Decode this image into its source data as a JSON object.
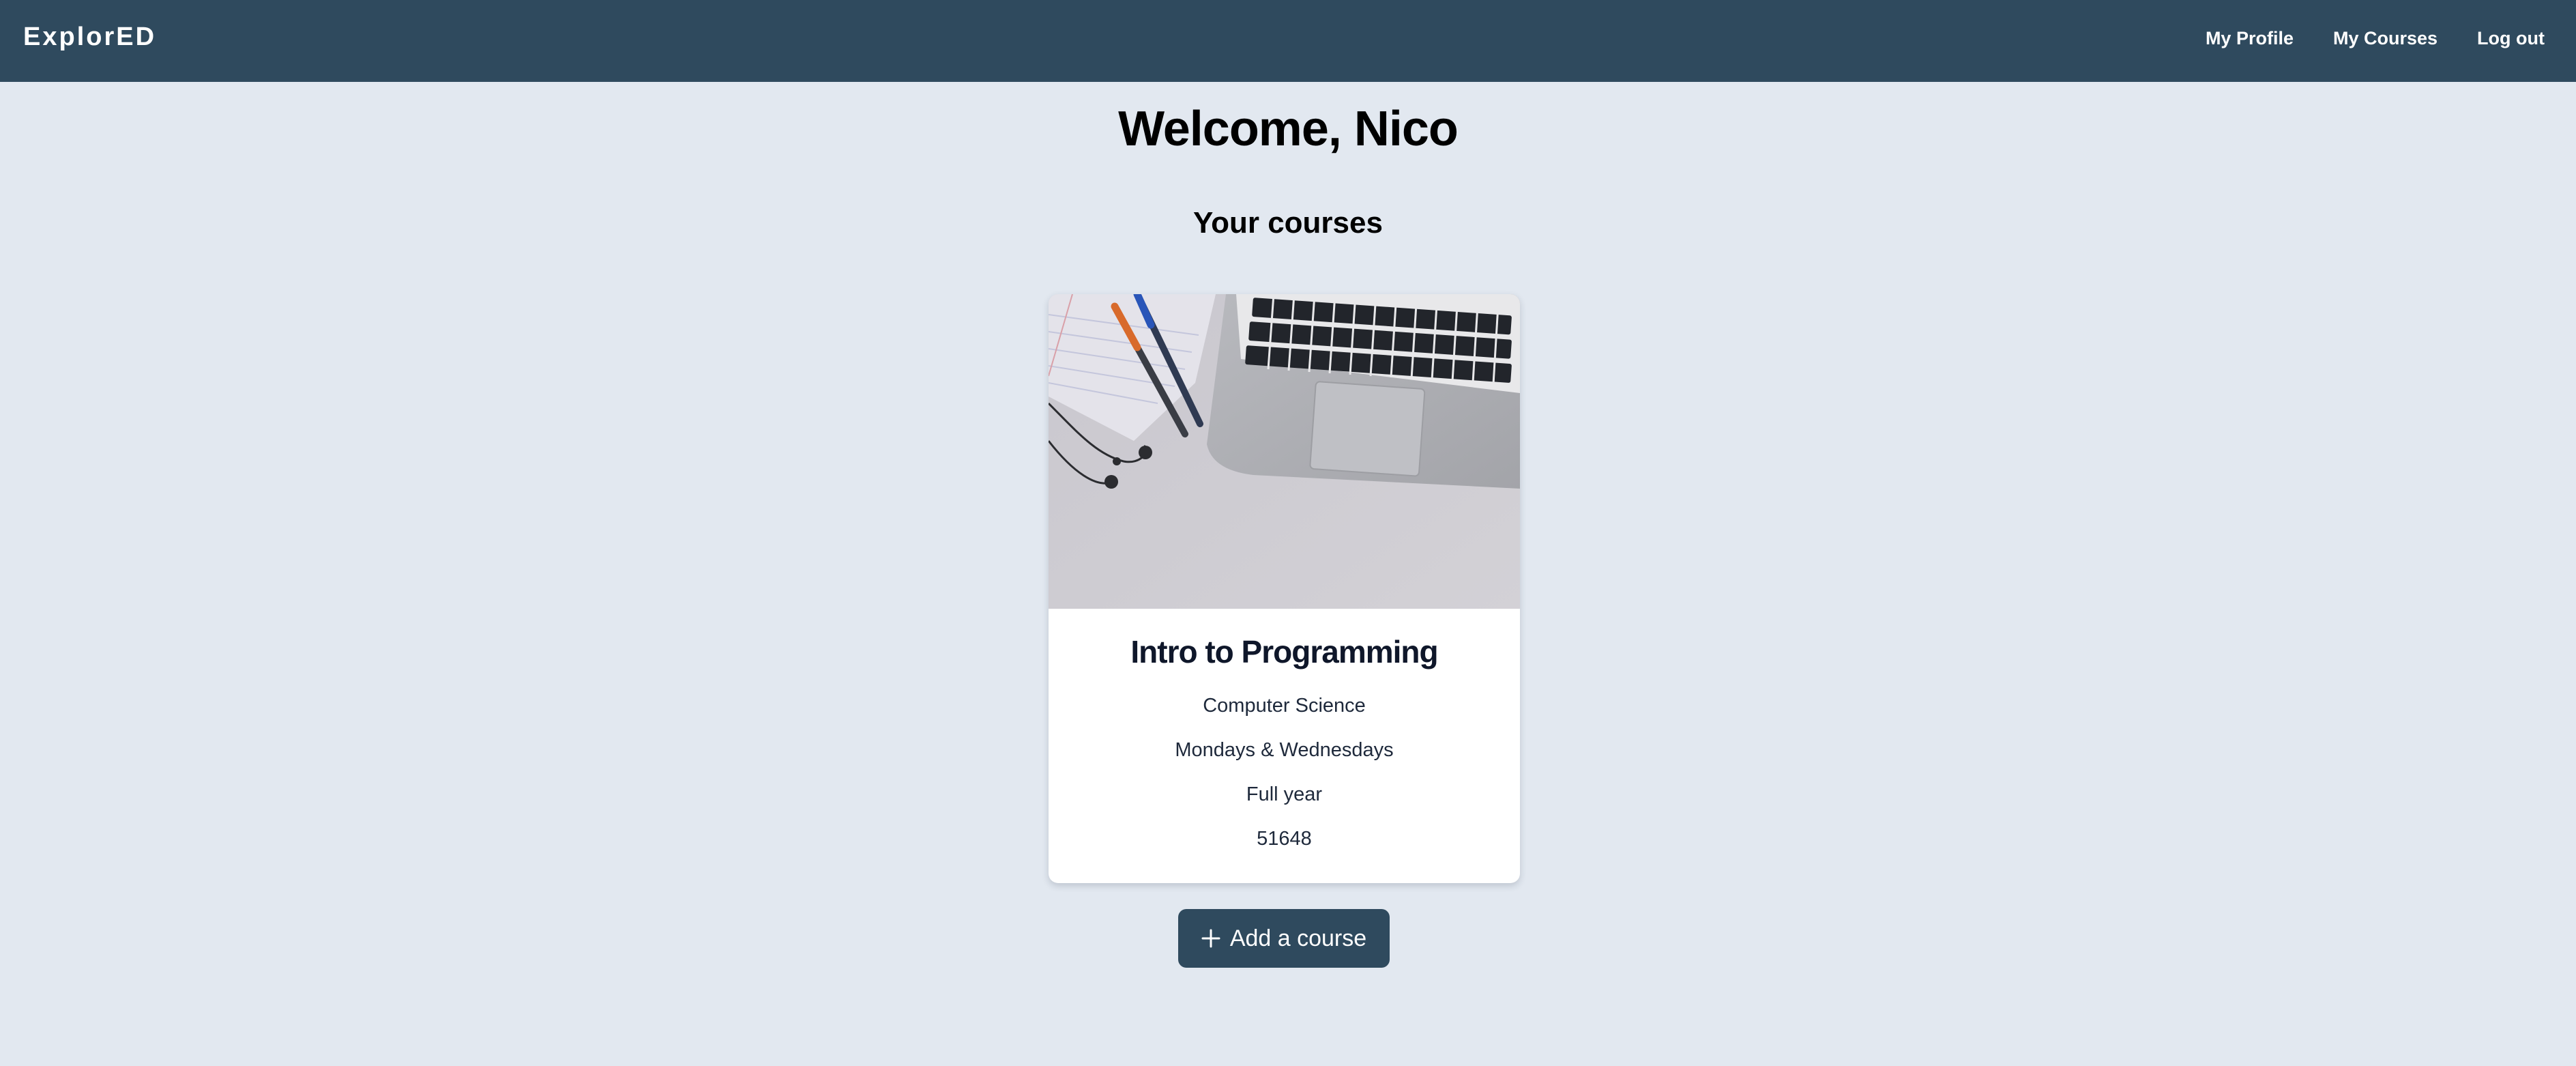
{
  "navbar": {
    "brand": "ExplorED",
    "links": [
      {
        "label": "My Profile"
      },
      {
        "label": "My Courses"
      },
      {
        "label": "Log out"
      }
    ]
  },
  "main": {
    "welcome": "Welcome, Nico",
    "section_title": "Your courses",
    "courses": [
      {
        "title": "Intro to Programming",
        "subject": "Computer Science",
        "schedule": "Mondays & Wednesdays",
        "duration": "Full year",
        "code": "51648",
        "image_icon": "laptop-desk-photo"
      }
    ],
    "add_course_label": "Add a course",
    "add_course_icon": "plus-icon"
  },
  "colors": {
    "nav_bg": "#2f4a5e",
    "page_bg": "#e2e8f0",
    "card_bg": "#ffffff",
    "button_bg": "#2f4a5e"
  }
}
